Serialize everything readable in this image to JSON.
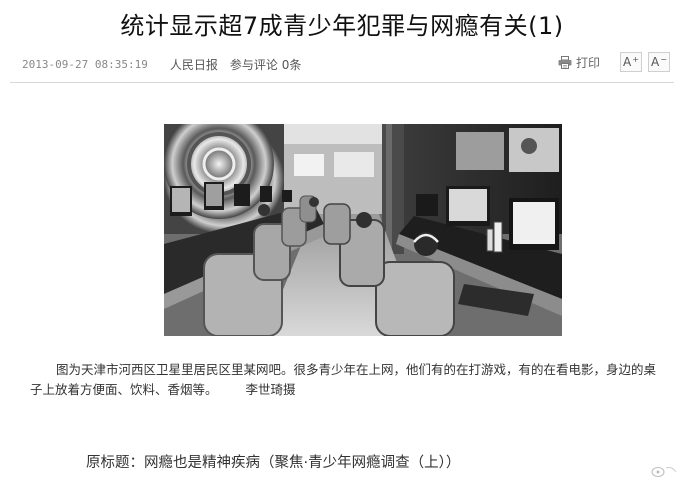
{
  "article": {
    "title": "统计显示超7成青少年犯罪与网瘾有关(1)",
    "date": "2013-09-27 08:35:19",
    "source": "人民日报",
    "comments_label": "参与评论",
    "comments_count": "0条",
    "print_label": "打印",
    "font_increase_label": "A",
    "font_decrease_label": "A",
    "font_increase_mark": "+",
    "font_decrease_mark": "−",
    "caption": "图为天津市河西区卫星里居民区里某网吧。很多青少年在上网，他们有的在打游戏，有的在看电影，身边的桌子上放着方便面、饮料、香烟等。",
    "credit": "李世琦摄",
    "original_title": "原标题：网瘾也是精神疾病（聚焦·青少年网瘾调查（上））"
  },
  "icons": {
    "print": "printer-icon",
    "watermark": "watermark-logo"
  },
  "colors": {
    "title": "#111111",
    "meta": "#777777",
    "body_text": "#333333",
    "divider": "#d8d8d8"
  }
}
